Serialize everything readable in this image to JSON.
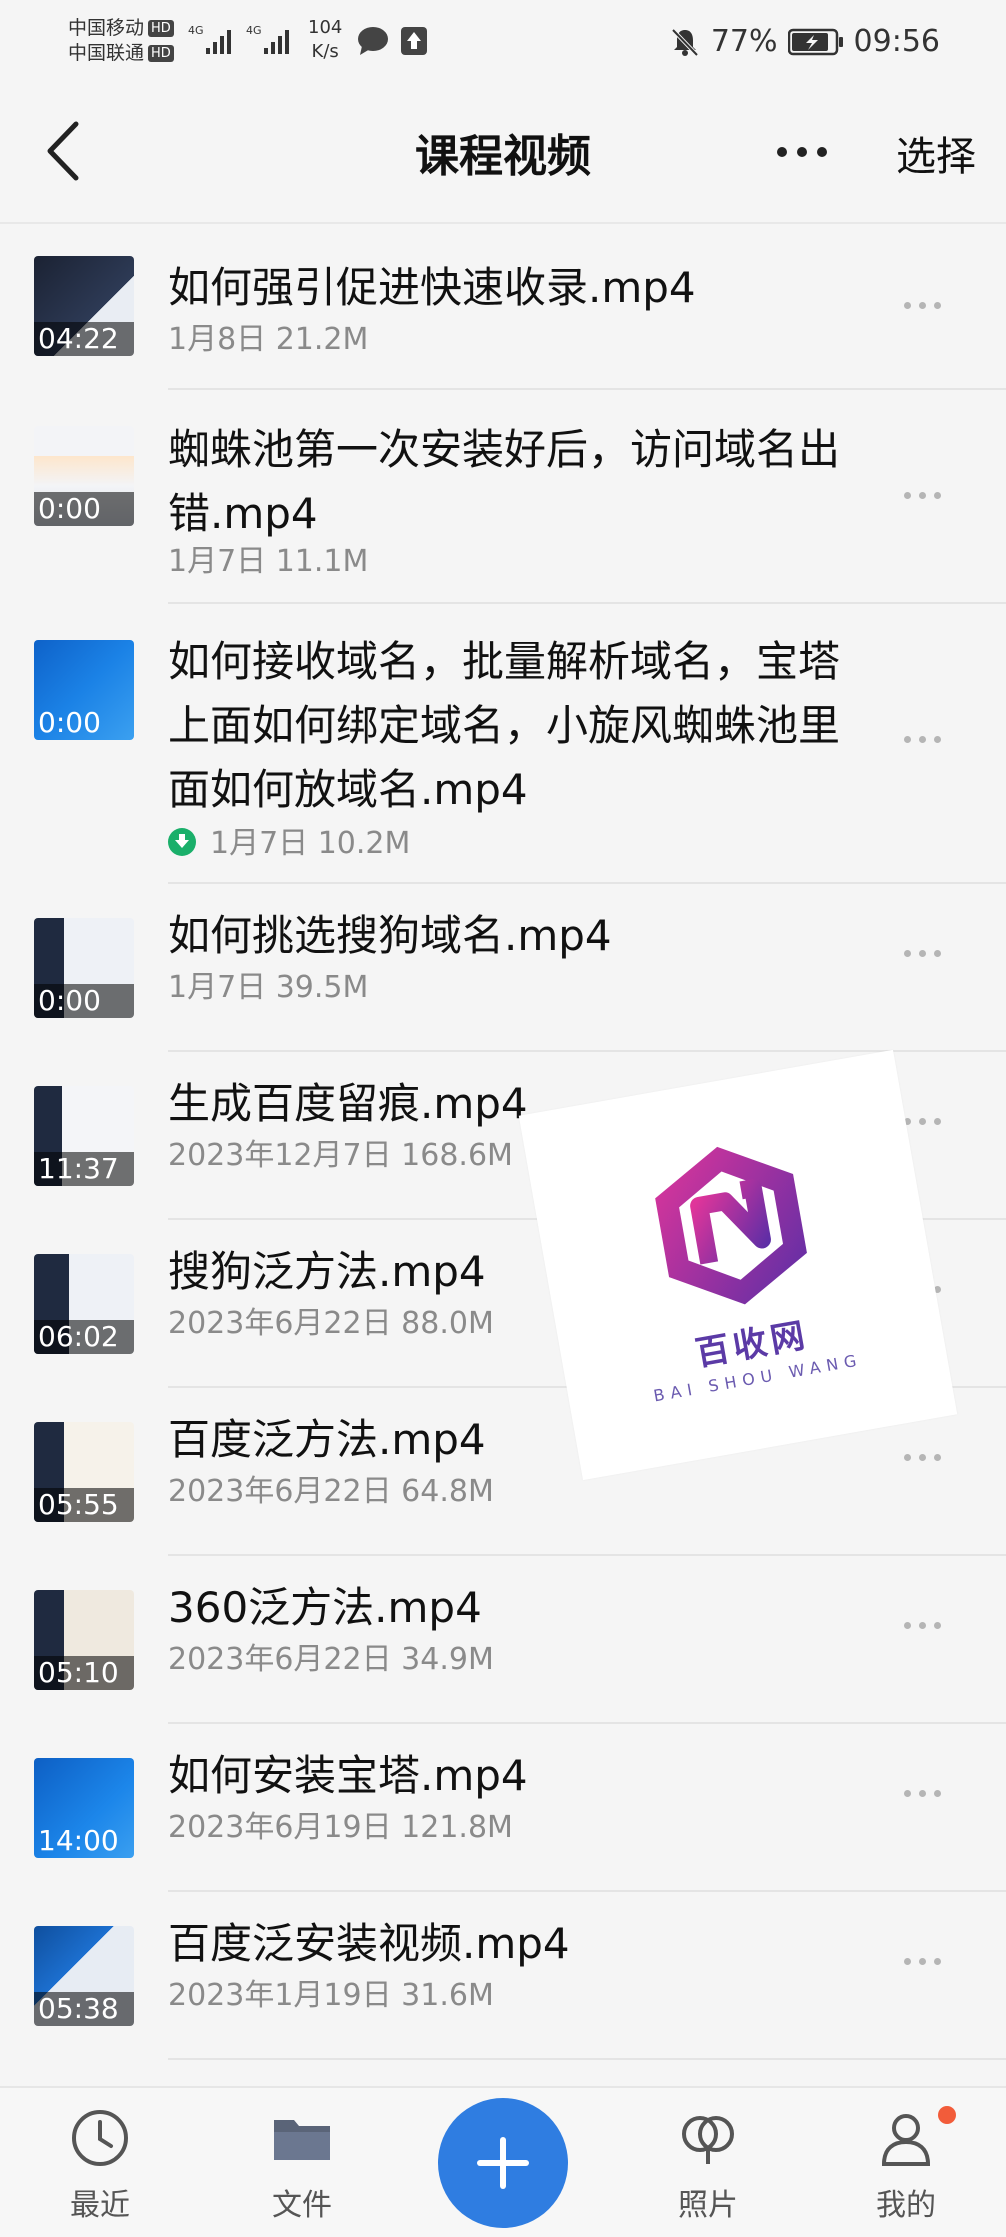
{
  "status": {
    "carrier1": "中国移动",
    "carrier2": "中国联通",
    "hd": "HD",
    "net": "4G",
    "speed_value": "104",
    "speed_unit": "K/s",
    "battery": "77%",
    "time": "09:56"
  },
  "header": {
    "title": "课程视频",
    "select_label": "选择"
  },
  "files": [
    {
      "name": "如何强引促进快速收录.mp4",
      "meta": "1月8日  21.2M",
      "duration": "04:22",
      "downloaded": false
    },
    {
      "name": "蜘蛛池第一次安装好后，访问域名出错.mp4",
      "meta": "1月7日  11.1M",
      "duration": "0:00",
      "downloaded": false
    },
    {
      "name": "如何接收域名，批量解析域名，宝塔上面如何绑定域名，小旋风蜘蛛池里面如何放域名.mp4",
      "meta": "1月7日  10.2M",
      "duration": "0:00",
      "downloaded": true
    },
    {
      "name": "如何挑选搜狗域名.mp4",
      "meta": "1月7日  39.5M",
      "duration": "0:00",
      "downloaded": false
    },
    {
      "name": "生成百度留痕.mp4",
      "meta": "2023年12月7日  168.6M",
      "duration": "11:37",
      "downloaded": false
    },
    {
      "name": "搜狗泛方法.mp4",
      "meta": "2023年6月22日  88.0M",
      "duration": "06:02",
      "downloaded": false
    },
    {
      "name": "百度泛方法.mp4",
      "meta": "2023年6月22日  64.8M",
      "duration": "05:55",
      "downloaded": false
    },
    {
      "name": "360泛方法.mp4",
      "meta": "2023年6月22日  34.9M",
      "duration": "05:10",
      "downloaded": false
    },
    {
      "name": "如何安装宝塔.mp4",
      "meta": "2023年6月19日  121.8M",
      "duration": "14:00",
      "downloaded": false
    },
    {
      "name": "百度泛安装视频.mp4",
      "meta": "2023年1月19日  31.6M",
      "duration": "05:38",
      "downloaded": false
    }
  ],
  "watermark": {
    "brand": "百收网",
    "sub": "BAI SHOU WANG"
  },
  "nav": {
    "recent": "最近",
    "files": "文件",
    "photos": "照片",
    "mine": "我的"
  },
  "colors": {
    "accent": "#2f7de1",
    "badge": "#f25c3a",
    "download": "#1aaf6a"
  }
}
